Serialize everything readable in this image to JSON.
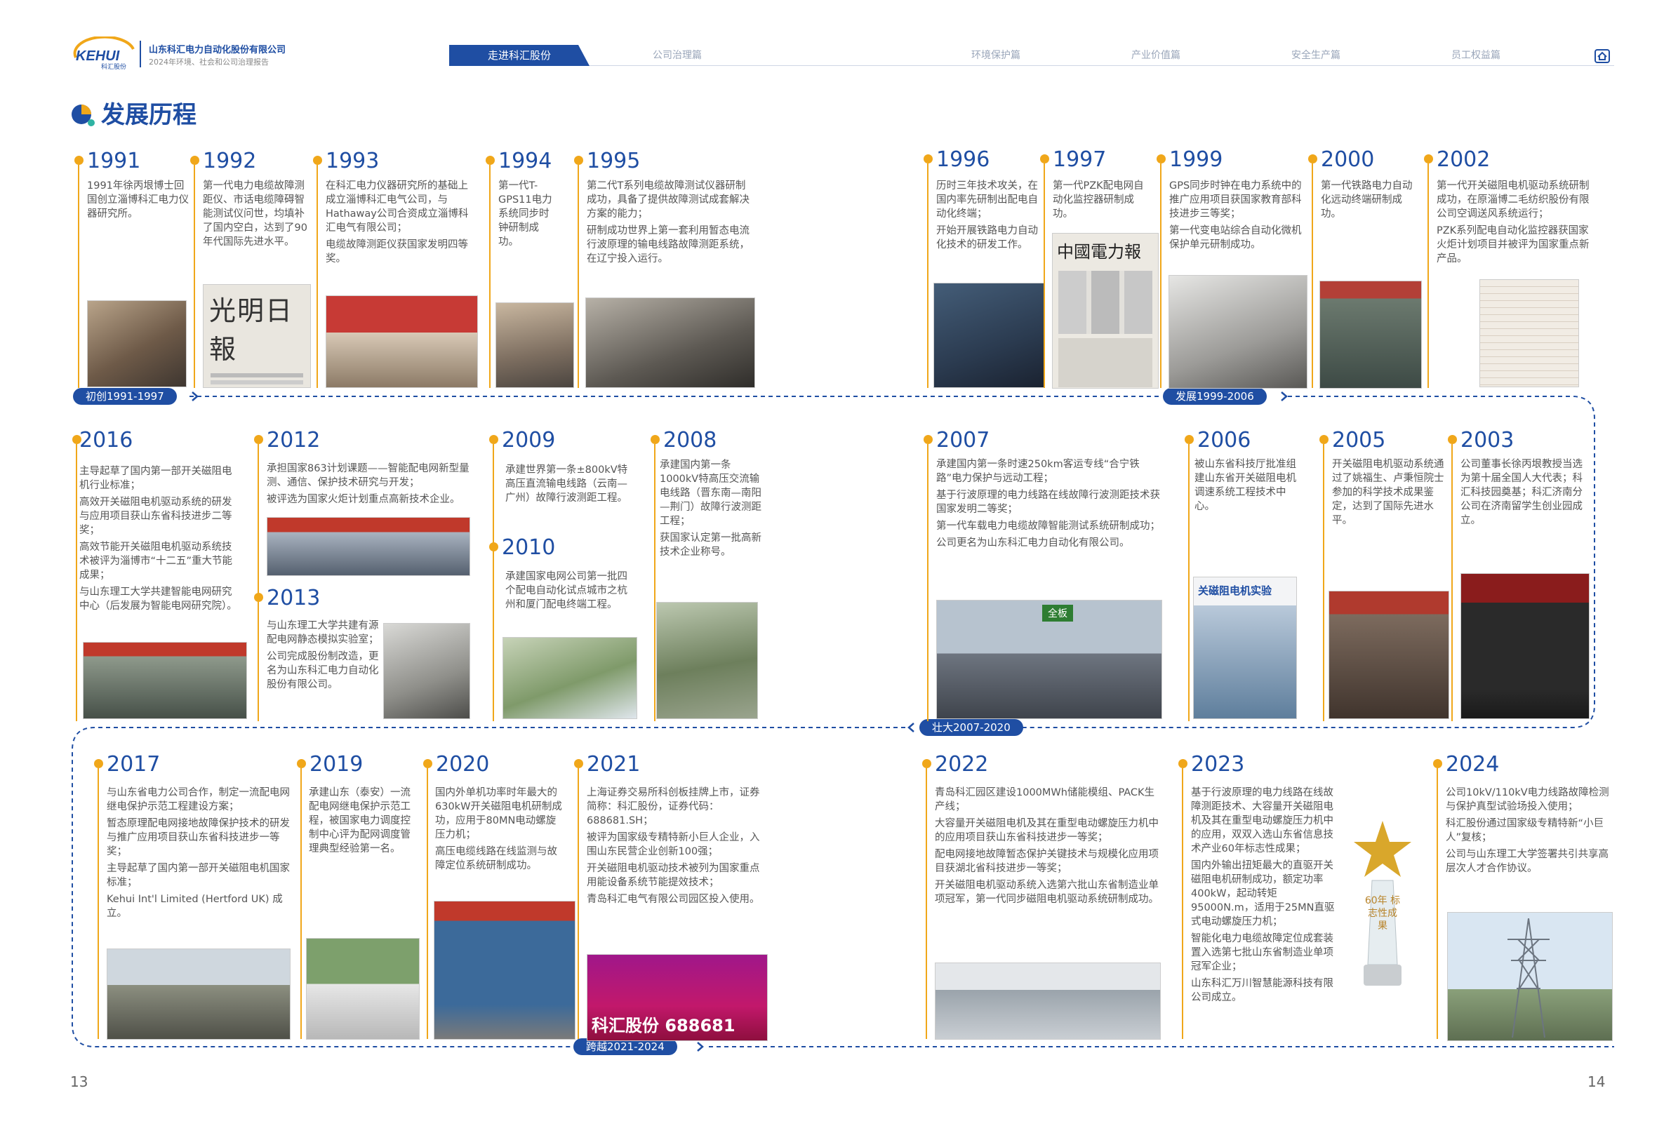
{
  "header": {
    "logo_text": "KEHUI",
    "logo_sub": "科汇股份",
    "company": "山东科汇电力自动化股份有限公司",
    "report": "2024年环境、社会和公司治理报告",
    "nav": [
      "走进科汇股份",
      "公司治理篇",
      "环境保护篇",
      "产业价值篇",
      "安全生产篇",
      "员工权益篇"
    ],
    "active_nav": 0
  },
  "page_title": "发展历程",
  "eras": [
    "初创1991-1997",
    "发展1999-2006",
    "壮大2007-2020",
    "跨越2021-2024"
  ],
  "events": [
    {
      "year": "1991",
      "paras": [
        "1991年徐丙垠博士回国创立淄博科汇电力仪器研究所。"
      ]
    },
    {
      "year": "1992",
      "paras": [
        "第一代电力电缆故障测距仪、市话电缆障碍智能测试仪问世，均填补了国内空白，达到了90年代国际先进水平。"
      ]
    },
    {
      "year": "1993",
      "paras": [
        "在科汇电力仪器研究所的基础上成立淄博科汇电气公司，与Hathaway公司合资成立淄博科汇电气有限公司；",
        "电缆故障测距仪获国家发明四等奖。"
      ]
    },
    {
      "year": "1994",
      "paras": [
        "第一代T-GPS11电力系统同步时钟研制成功。"
      ]
    },
    {
      "year": "1995",
      "paras": [
        "第二代T系列电缆故障测试仪器研制成功，具备了提供故障测试成套解决方案的能力；",
        "研制成功世界上第一套利用暂态电流行波原理的输电线路故障测距系统，在辽宁投入运行。"
      ]
    },
    {
      "year": "1996",
      "paras": [
        "历时三年技术攻关，在国内率先研制出配电自动化终端；",
        "开始开展铁路电力自动化技术的研发工作。"
      ]
    },
    {
      "year": "1997",
      "paras": [
        "第一代PZK配电网自动化监控器研制成功。"
      ]
    },
    {
      "year": "1999",
      "paras": [
        "GPS同步时钟在电力系统中的推广应用项目获国家教育部科技进步三等奖；",
        "第一代变电站综合自动化微机保护单元研制成功。"
      ]
    },
    {
      "year": "2000",
      "paras": [
        "第一代铁路电力自动化远动终端研制成功。"
      ]
    },
    {
      "year": "2002",
      "paras": [
        "第一代开关磁阻电机驱动系统研制成功，在原淄博二毛纺织股份有限公司空调送风系统运行；",
        "PZK系列配电自动化监控器获国家火炬计划项目并被评为国家重点新产品。"
      ]
    },
    {
      "year": "2016",
      "paras": [
        "主导起草了国内第一部开关磁阻电机行业标准；",
        "高效开关磁阻电机驱动系统的研发与应用项目获山东省科技进步二等奖；",
        "高效节能开关磁阻电机驱动系统技术被评为淄博市“十二五”重大节能成果；",
        "与山东理工大学共建智能电网研究中心（后发展为智能电网研究院）。"
      ]
    },
    {
      "year": "2012",
      "paras": [
        "承担国家863计划课题——智能配电网新型量测、通信、保护技术研究与开发；",
        "被评选为国家火炬计划重点高新技术企业。"
      ]
    },
    {
      "year": "2013",
      "paras": [
        "与山东理工大学共建有源配电网静态模拟实验室；",
        "公司完成股份制改造，更名为山东科汇电力自动化股份有限公司。"
      ]
    },
    {
      "year": "2009",
      "paras": [
        "承建世界第一条±800kV特高压直流输电线路（云南—广州）故障行波测距工程。"
      ]
    },
    {
      "year": "2010",
      "paras": [
        "承建国家电网公司第一批四个配电自动化试点城市之杭州和厦门配电终端工程。"
      ]
    },
    {
      "year": "2008",
      "paras": [
        "承建国内第一条1000kV特高压交流输电线路（晋东南—南阳—荆门）故障行波测距工程；",
        "获国家认定第一批高新技术企业称号。"
      ]
    },
    {
      "year": "2007",
      "paras": [
        "承建国内第一条时速250km客运专线“合宁铁路”电力保护与远动工程；",
        "基于行波原理的电力线路在线故障行波测距技术获国家发明二等奖；",
        "第一代车载电力电缆故障智能测试系统研制成功；",
        "公司更名为山东科汇电力自动化有限公司。"
      ]
    },
    {
      "year": "2006",
      "paras": [
        "被山东省科技厅批准组建山东省开关磁阻电机调速系统工程技术中心。"
      ]
    },
    {
      "year": "2005",
      "paras": [
        "开关磁阻电机驱动系统通过了姚福生、卢秉恒院士参加的科学技术成果鉴定，达到了国际先进水平。"
      ]
    },
    {
      "year": "2003",
      "paras": [
        "公司董事长徐丙垠教授当选为第十届全国人大代表；科汇科技园奠基；科汇济南分公司在济南留学生创业园成立。"
      ]
    },
    {
      "year": "2017",
      "paras": [
        "与山东省电力公司合作，制定一流配电网继电保护示范工程建设方案；",
        "暂态原理配电网接地故障保护技术的研发与推广应用项目获山东省科技进步一等奖；",
        "主导起草了国内第一部开关磁阻电机国家标准；",
        "Kehui Int'l Limited (Hertford UK) 成立。"
      ]
    },
    {
      "year": "2019",
      "paras": [
        "承建山东（泰安）一流配电网继电保护示范工程，被国家电力调度控制中心评为配网调度管理典型经验第一名。"
      ]
    },
    {
      "year": "2020",
      "paras": [
        "国内外单机功率时年最大的630kW开关磁阻电机研制成功，应用于80MN电动螺旋压力机；",
        "高压电缆线路在线监测与故障定位系统研制成功。"
      ]
    },
    {
      "year": "2021",
      "paras": [
        "上海证券交易所科创板挂牌上市，证券简称：科汇股份，证券代码：688681.SH；",
        "被评为国家级专精特新小巨人企业，入围山东民营企业创新100强；",
        "开关磁阻电机驱动技术被列为国家重点用能设备系统节能提效技术；",
        "青岛科汇电气有限公司园区投入使用。"
      ]
    },
    {
      "year": "2022",
      "paras": [
        "青岛科汇园区建设1000MWh储能模组、PACK生产线；",
        "大容量开关磁阻电机及其在重型电动螺旋压力机中的应用项目获山东省科技进步一等奖；",
        "配电网接地故障暂态保护关键技术与规模化应用项目获湖北省科技进步一等奖；",
        "开关磁阻电机驱动系统入选第六批山东省制造业单项冠军，第一代同步磁阻电机驱动系统研制成功。"
      ]
    },
    {
      "year": "2023",
      "paras": [
        "基于行波原理的电力线路在线故障测距技术、大容量开关磁阻电机及其在重型电动螺旋压力机中的应用，双双入选山东省信息技术产业60年标志性成果；",
        "国内外输出扭矩最大的直驱开关磁阻电机研制成功，额定功率400kW，起动转矩95000N.m，适用于25MN直驱式电动螺旋压力机；",
        "智能化电力电缆故障定位成套装置入选第七批山东省制造业单项冠军企业；",
        "山东科汇万川智慧能源科技有限公司成立。"
      ]
    },
    {
      "year": "2024",
      "paras": [
        "公司10kV/110kV电力线路故障检测与保护真型试验场投入使用；",
        "科汇股份通过国家级专精特新“小巨人”复核；",
        "公司与山东理工大学签署共引共享高层次人才合作协议。"
      ]
    }
  ],
  "photo_texts": {
    "p1992": "光明日報",
    "p1997": "中國電力報",
    "p2006": "关磁阻电机实验",
    "p2007": "全板",
    "p2021": "科汇股份 688681",
    "p2023": "60年 标志性成果"
  },
  "page_left": "13",
  "page_right": "14",
  "colors": {
    "primary": "#1f4ea3",
    "accent": "#f0a71a"
  }
}
